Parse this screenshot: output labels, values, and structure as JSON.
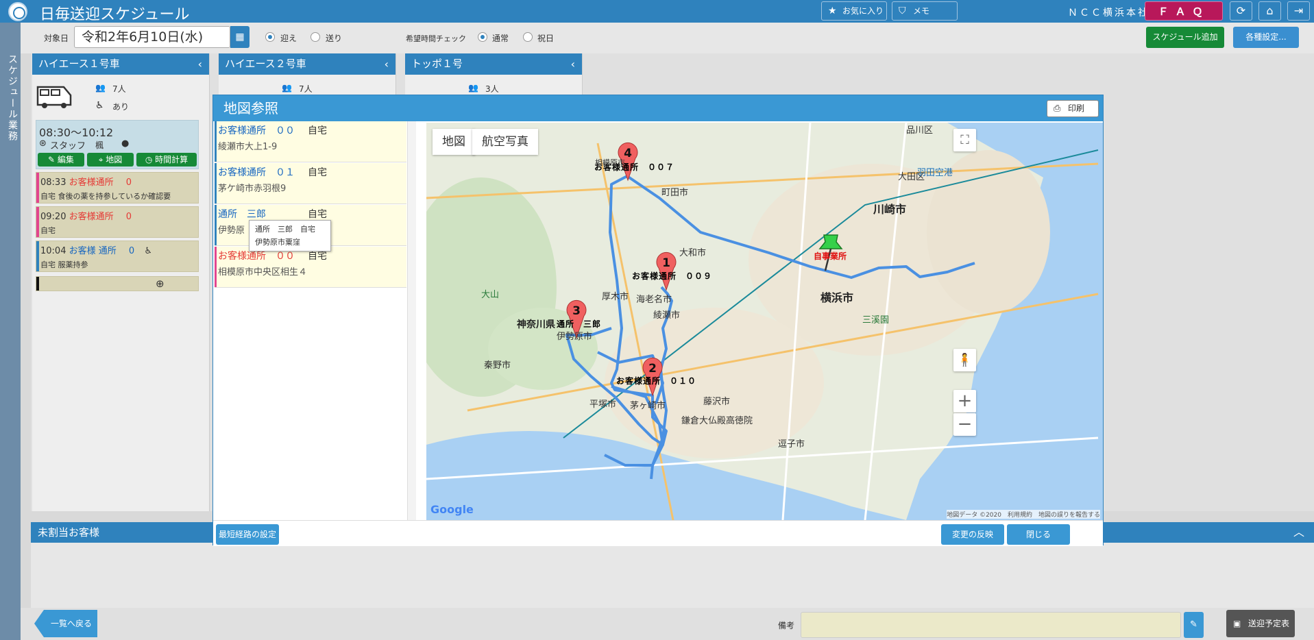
{
  "header": {
    "title": "日毎送迎スケジュール",
    "favorites": "お気に入り",
    "memo": "メモ",
    "company": "ＮＣＣ横浜本社",
    "faq": "ＦＡＱ"
  },
  "sidebar": {
    "label": "スケジュール業務"
  },
  "toolbar": {
    "date_label": "対象日",
    "date_value": "令和2年6月10日(水)",
    "pickup": "迎え",
    "dropoff": "送り",
    "hope_check": "希望時間チェック",
    "normal": "通常",
    "holiday": "祝日",
    "add_schedule": "スケジュール追加",
    "settings": "各種設定..."
  },
  "vehicles": [
    {
      "name": "ハイエース１号車",
      "capacity": "7人",
      "wheelchair": "あり",
      "time": "08:30〜10:12",
      "staff_label": "スタッフ",
      "staff_name": "楓",
      "actions": [
        "編集",
        "地図",
        "時間計算"
      ],
      "trips": [
        {
          "time": "08:33",
          "name": "お客様通所",
          "count": "0",
          "note": "自宅 食後の薬を持参しているか確認要"
        },
        {
          "time": "09:20",
          "name": "お客様通所",
          "count": "0",
          "note": "自宅"
        },
        {
          "time": "10:04",
          "name": "お客様 通所",
          "count": "0",
          "note": "自宅 服薬持参"
        }
      ]
    },
    {
      "name": "ハイエース２号車",
      "capacity": "7人"
    },
    {
      "name": "トッポ１号",
      "capacity": "3人"
    }
  ],
  "modal": {
    "title": "地図参照",
    "print": "印刷",
    "stops": [
      {
        "name": "お客様通所　００",
        "place": "自宅",
        "address": "綾瀬市大上1-9"
      },
      {
        "name": "お客様通所　０１",
        "place": "自宅",
        "address": "茅ケ崎市赤羽根9"
      },
      {
        "name": "通所　三郎",
        "place": "自宅",
        "address": "伊勢原"
      },
      {
        "name": "お客様通所　００",
        "place": "自宅",
        "address": "相模原市中央区相生４"
      }
    ],
    "tooltip": {
      "line1": "通所　三郎　自宅",
      "line2": "伊勢原市粟窪"
    },
    "map": {
      "tab_map": "地図",
      "tab_aerial": "航空写真",
      "google": "Google",
      "attribution": "地図データ ©2020　利用規約　地図の誤りを報告する",
      "labels": {
        "p4": "お客様通所　００７",
        "p1": "お客様通所　００９",
        "p3": "通所　三郎",
        "p2": "お客様通所　０１０",
        "office": "自事業所",
        "kawasaki": "川崎市",
        "yokohama": "横浜市",
        "kanagawa": "神奈川県",
        "machida": "町田市",
        "yamato": "大和市",
        "ebina": "海老名市",
        "ayase": "綾瀬市",
        "atsugi": "厚木市",
        "isehara": "伊勢原市",
        "hadano": "秦野市",
        "hiratsuka": "平塚市",
        "chigasaki": "茅ヶ崎市",
        "fujisawa": "藤沢市",
        "zushi": "逗子市",
        "ota": "大田区",
        "shinagawa": "品川区",
        "oyama": "大山",
        "sankeien": "三溪園",
        "haneda": "羽田空港",
        "kamakura": "鎌倉大仏殿高徳院",
        "sagamihara": "相模原市"
      },
      "pin_numbers": [
        "4",
        "1",
        "3",
        "2"
      ]
    },
    "footer": {
      "shortest": "最短経路の設定",
      "apply": "変更の反映",
      "close": "閉じる"
    }
  },
  "unassigned": {
    "title": "未割当お客様"
  },
  "bottom": {
    "back": "一覧へ戻る",
    "memo_label": "備考",
    "plan": "送迎予定表"
  },
  "colors": {
    "primary": "#2f82bd",
    "green": "#168a37",
    "faq": "#b8185a",
    "customer_red": "#e53935",
    "customer_blue": "#1565c0",
    "route": "#4a90e2",
    "pin": "#f06060"
  }
}
